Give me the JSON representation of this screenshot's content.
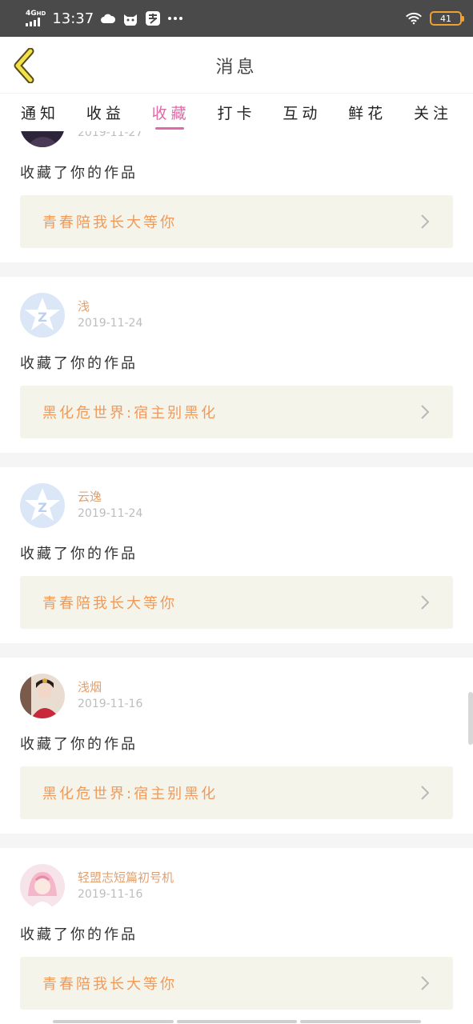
{
  "status": {
    "network": "4G",
    "hd": "HD",
    "time": "13:37",
    "battery": "41"
  },
  "header": {
    "title": "消息"
  },
  "tabs": [
    {
      "label": "通知"
    },
    {
      "label": "收益"
    },
    {
      "label": "收藏",
      "active": true
    },
    {
      "label": "打卡"
    },
    {
      "label": "互动"
    },
    {
      "label": "鲜花"
    },
    {
      "label": "关注"
    }
  ],
  "items": [
    {
      "user": "",
      "date": "2019-11-27",
      "action": "收藏了你的作品",
      "work": "青春陪我长大等你",
      "avatar": "dark-portrait"
    },
    {
      "user": "浅",
      "date": "2019-11-24",
      "action": "收藏了你的作品",
      "work": "黑化危世界:宿主别黑化",
      "avatar": "default-star"
    },
    {
      "user": "云逸",
      "date": "2019-11-24",
      "action": "收藏了你的作品",
      "work": "青春陪我长大等你",
      "avatar": "default-star"
    },
    {
      "user": "浅烟",
      "date": "2019-11-16",
      "action": "收藏了你的作品",
      "work": "黑化危世界:宿主别黑化",
      "avatar": "costume-portrait"
    },
    {
      "user": "轻盟志短篇初号机",
      "date": "2019-11-16",
      "action": "收藏了你的作品",
      "work": "青春陪我长大等你",
      "avatar": "anime-girl"
    }
  ],
  "colors": {
    "accent": "#e06aa8",
    "work_text": "#ef9a5a",
    "work_bg": "#f5f4ea",
    "username": "#e0a070"
  }
}
